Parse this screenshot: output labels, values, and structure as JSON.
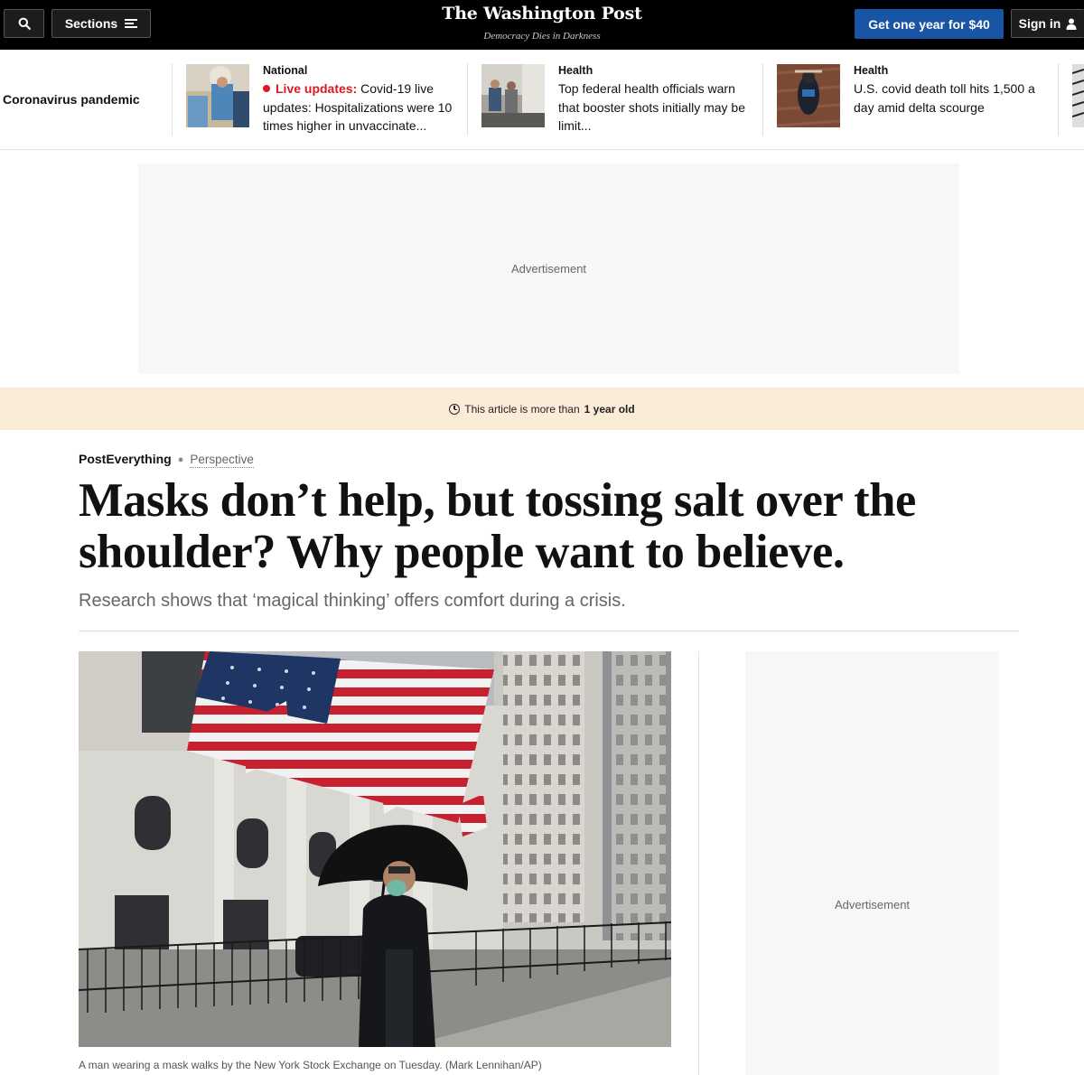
{
  "header": {
    "search_icon": "search-icon",
    "sections_label": "Sections",
    "logo_text": "The Washington Post",
    "tagline": "Democracy Dies in Darkness",
    "subscribe_label": "Get one year for $40",
    "signin_label": "Sign in",
    "accent_color": "#1955a5"
  },
  "strip": {
    "label": "Coronavirus pandemic",
    "items": [
      {
        "kicker": "National",
        "live_label": "Live updates:",
        "headline": "Covid-19 live updates: Hospitalizations were 10 times higher in unvaccinate..."
      },
      {
        "kicker": "Health",
        "headline": "Top federal health officials warn that booster shots initially may be limit..."
      },
      {
        "kicker": "Health",
        "headline": "U.S. covid death toll hits 1,500 a day amid delta scourge"
      }
    ]
  },
  "ads": {
    "top_label": "Advertisement",
    "side_label": "Advertisement"
  },
  "banner": {
    "text_prefix": "This article is more than",
    "text_bold": "1 year old"
  },
  "article": {
    "section": "PostEverything",
    "label": "Perspective",
    "title": "Masks don’t help, but tossing salt over the shoulder? Why people want to believe.",
    "dek": "Research shows that ‘magical thinking’ offers comfort during a crisis.",
    "caption": "A man wearing a mask walks by the New York Stock Exchange on Tuesday. (Mark Lennihan/AP)"
  }
}
